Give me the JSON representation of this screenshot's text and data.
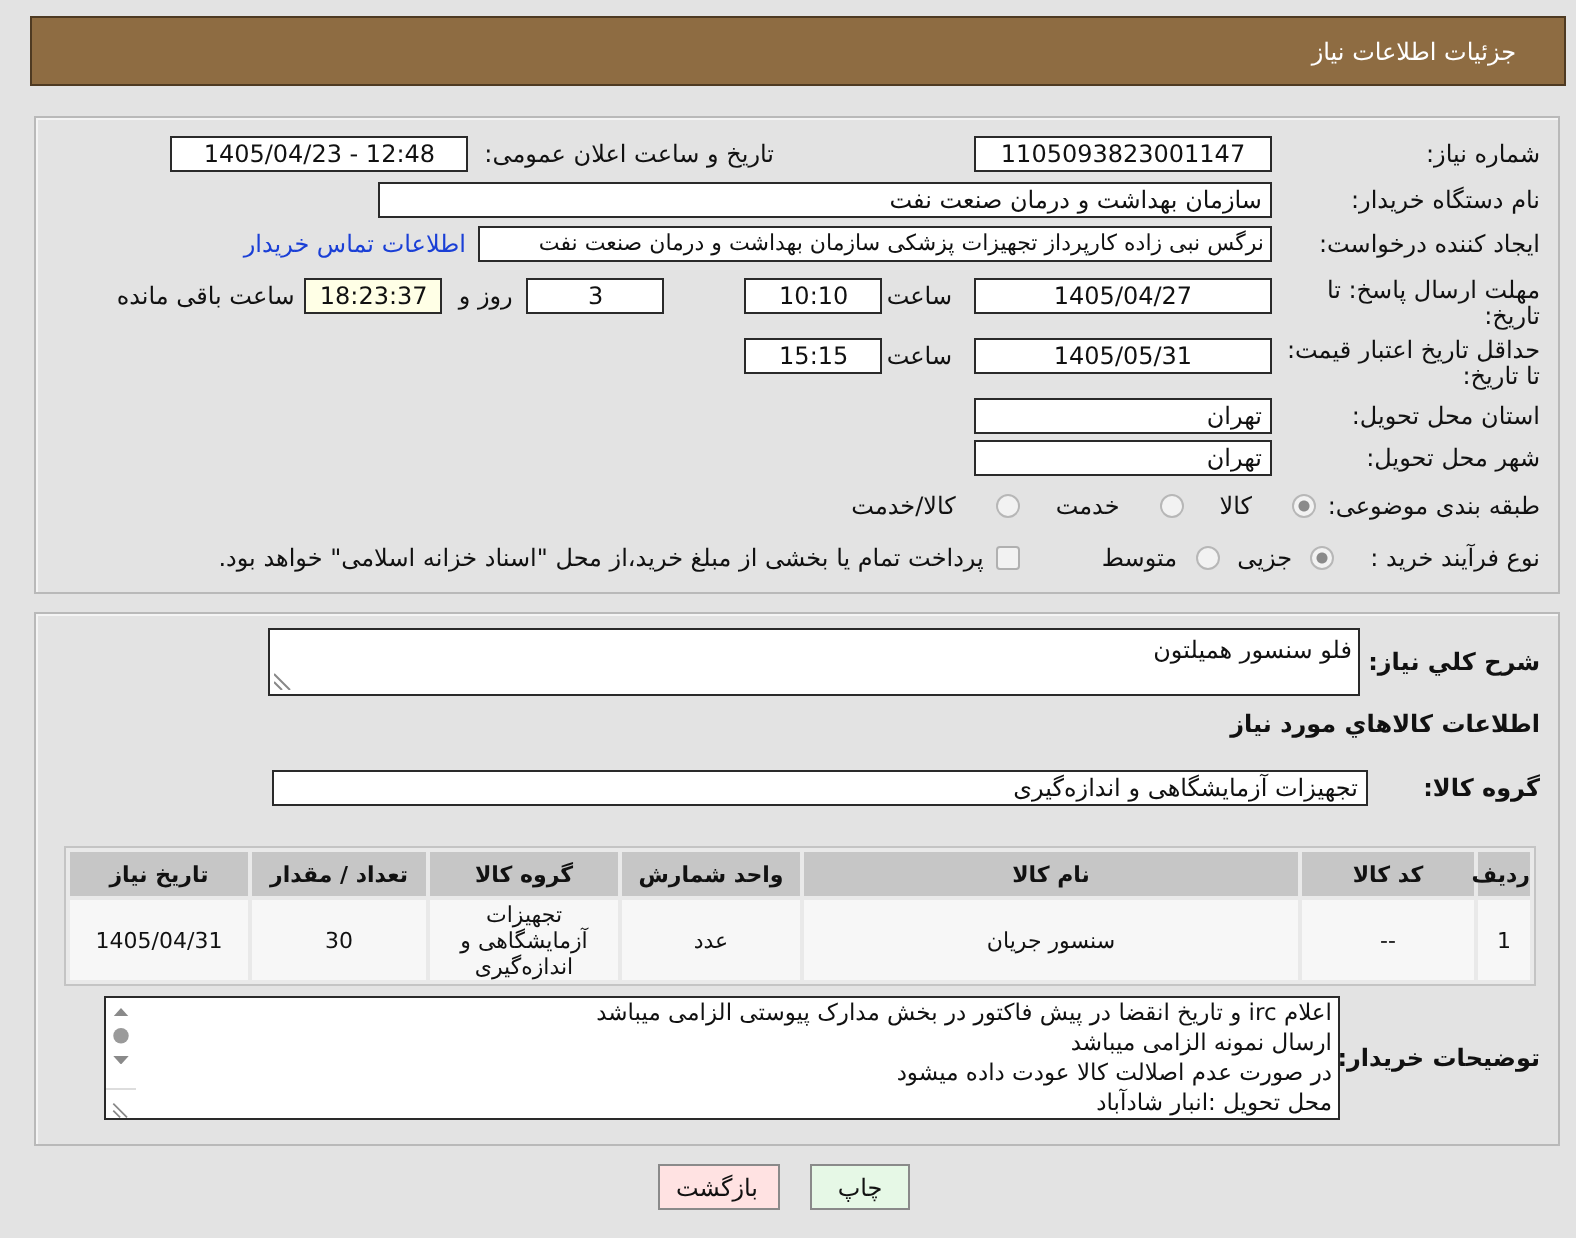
{
  "header": {
    "title": "جزئیات اطلاعات نیاز"
  },
  "need_number": {
    "label": "شماره نیاز:",
    "value": "1105093823001147"
  },
  "announce": {
    "label": "تاریخ و ساعت اعلان عمومی:",
    "value": "1405/04/23 - 12:48"
  },
  "buyer_org": {
    "label": "نام دستگاه خریدار:",
    "value": "سازمان بهداشت و درمان صنعت نفت"
  },
  "requester": {
    "label": "ایجاد کننده درخواست:",
    "value": "نرگس نبی زاده کارپرداز تجهیزات پزشکی سازمان بهداشت و درمان صنعت نفت",
    "contact_link": "اطلاعات تماس خریدار"
  },
  "reply_deadline": {
    "label": "مهلت ارسال پاسخ: تا تاریخ:",
    "date": "1405/04/27",
    "time_label": "ساعت",
    "time": "10:10",
    "days": "3",
    "days_label": "روز و",
    "remaining": "18:23:37",
    "remaining_label": "ساعت باقی مانده"
  },
  "price_validity": {
    "label": "حداقل تاریخ اعتبار قیمت: تا تاریخ:",
    "date": "1405/05/31",
    "time_label": "ساعت",
    "time": "15:15"
  },
  "delivery_province": {
    "label": "استان محل تحویل:",
    "value": "تهران"
  },
  "delivery_city": {
    "label": "شهر محل تحویل:",
    "value": "تهران"
  },
  "subject_category": {
    "label": "طبقه بندی موضوعی:",
    "options": [
      {
        "label": "کالا",
        "selected": true
      },
      {
        "label": "خدمت",
        "selected": false
      },
      {
        "label": "کالا/خدمت",
        "selected": false
      }
    ]
  },
  "purchase_process": {
    "label": "نوع فرآیند خرید :",
    "options": [
      {
        "label": "جزیی",
        "selected": true
      },
      {
        "label": "متوسط",
        "selected": false
      }
    ],
    "treasury_payment": {
      "label": "پرداخت تمام یا بخشی از مبلغ خرید،از محل \"اسناد خزانه اسلامی\" خواهد بود.",
      "checked": false
    }
  },
  "description": {
    "label": "شرح كلي نياز:",
    "value": "فلو سنسور همیلتون"
  },
  "goods_heading": "اطلاعات كالاهاي مورد نياز",
  "goods_group": {
    "label": "گروه کالا:",
    "value": "تجهیزات آزمایشگاهی و اندازه‌گیری"
  },
  "table": {
    "columns": [
      "ردیف",
      "کد کالا",
      "نام کالا",
      "واحد شمارش",
      "گروه کالا",
      "تعداد / مقدار",
      "تاریخ نیاز"
    ],
    "rows": [
      [
        "1",
        "--",
        "سنسور جریان",
        "عدد",
        "تجهیزات آزمایشگاهی و اندازه‌گیری",
        "30",
        "1405/04/31"
      ]
    ]
  },
  "buyer_notes": {
    "label": "توضیحات خریدار:",
    "lines": [
      "اعلام irc و تاریخ انقضا در پیش فاکتور در بخش مدارک پیوستی الزامی میباشد",
      "ارسال نمونه الزامی میباشد",
      "در صورت عدم اصلالت کالا عودت داده میشود",
      "محل تحویل :انبار شادآباد"
    ]
  },
  "buttons": [
    {
      "label": "چاپ",
      "kind": "print"
    },
    {
      "label": "بازگشت",
      "kind": "back"
    }
  ]
}
